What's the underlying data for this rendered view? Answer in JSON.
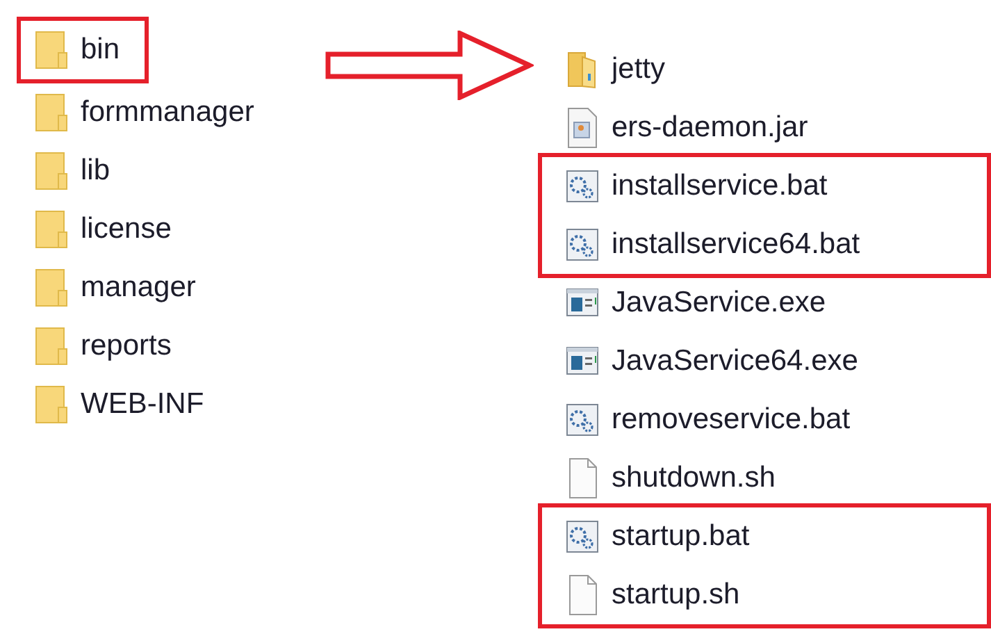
{
  "left_panel": {
    "groups": [
      {
        "highlighted": true,
        "items": [
          {
            "name": "bin",
            "kind": "folder"
          }
        ]
      },
      {
        "highlighted": false,
        "items": [
          {
            "name": "formmanager",
            "kind": "folder"
          },
          {
            "name": "lib",
            "kind": "folder"
          },
          {
            "name": "license",
            "kind": "folder"
          },
          {
            "name": "manager",
            "kind": "folder"
          },
          {
            "name": "reports",
            "kind": "folder"
          },
          {
            "name": "WEB-INF",
            "kind": "folder"
          }
        ]
      }
    ]
  },
  "right_panel": {
    "groups": [
      {
        "highlighted": false,
        "items": [
          {
            "name": "jetty",
            "kind": "folder"
          },
          {
            "name": "ers-daemon.jar",
            "kind": "jar"
          }
        ]
      },
      {
        "highlighted": true,
        "items": [
          {
            "name": "installservice.bat",
            "kind": "bat"
          },
          {
            "name": "installservice64.bat",
            "kind": "bat"
          }
        ]
      },
      {
        "highlighted": false,
        "items": [
          {
            "name": "JavaService.exe",
            "kind": "exe"
          },
          {
            "name": "JavaService64.exe",
            "kind": "exe"
          },
          {
            "name": "removeservice.bat",
            "kind": "bat"
          },
          {
            "name": "shutdown.sh",
            "kind": "sh"
          }
        ]
      },
      {
        "highlighted": true,
        "items": [
          {
            "name": "startup.bat",
            "kind": "bat"
          },
          {
            "name": "startup.sh",
            "kind": "sh"
          }
        ]
      }
    ]
  }
}
